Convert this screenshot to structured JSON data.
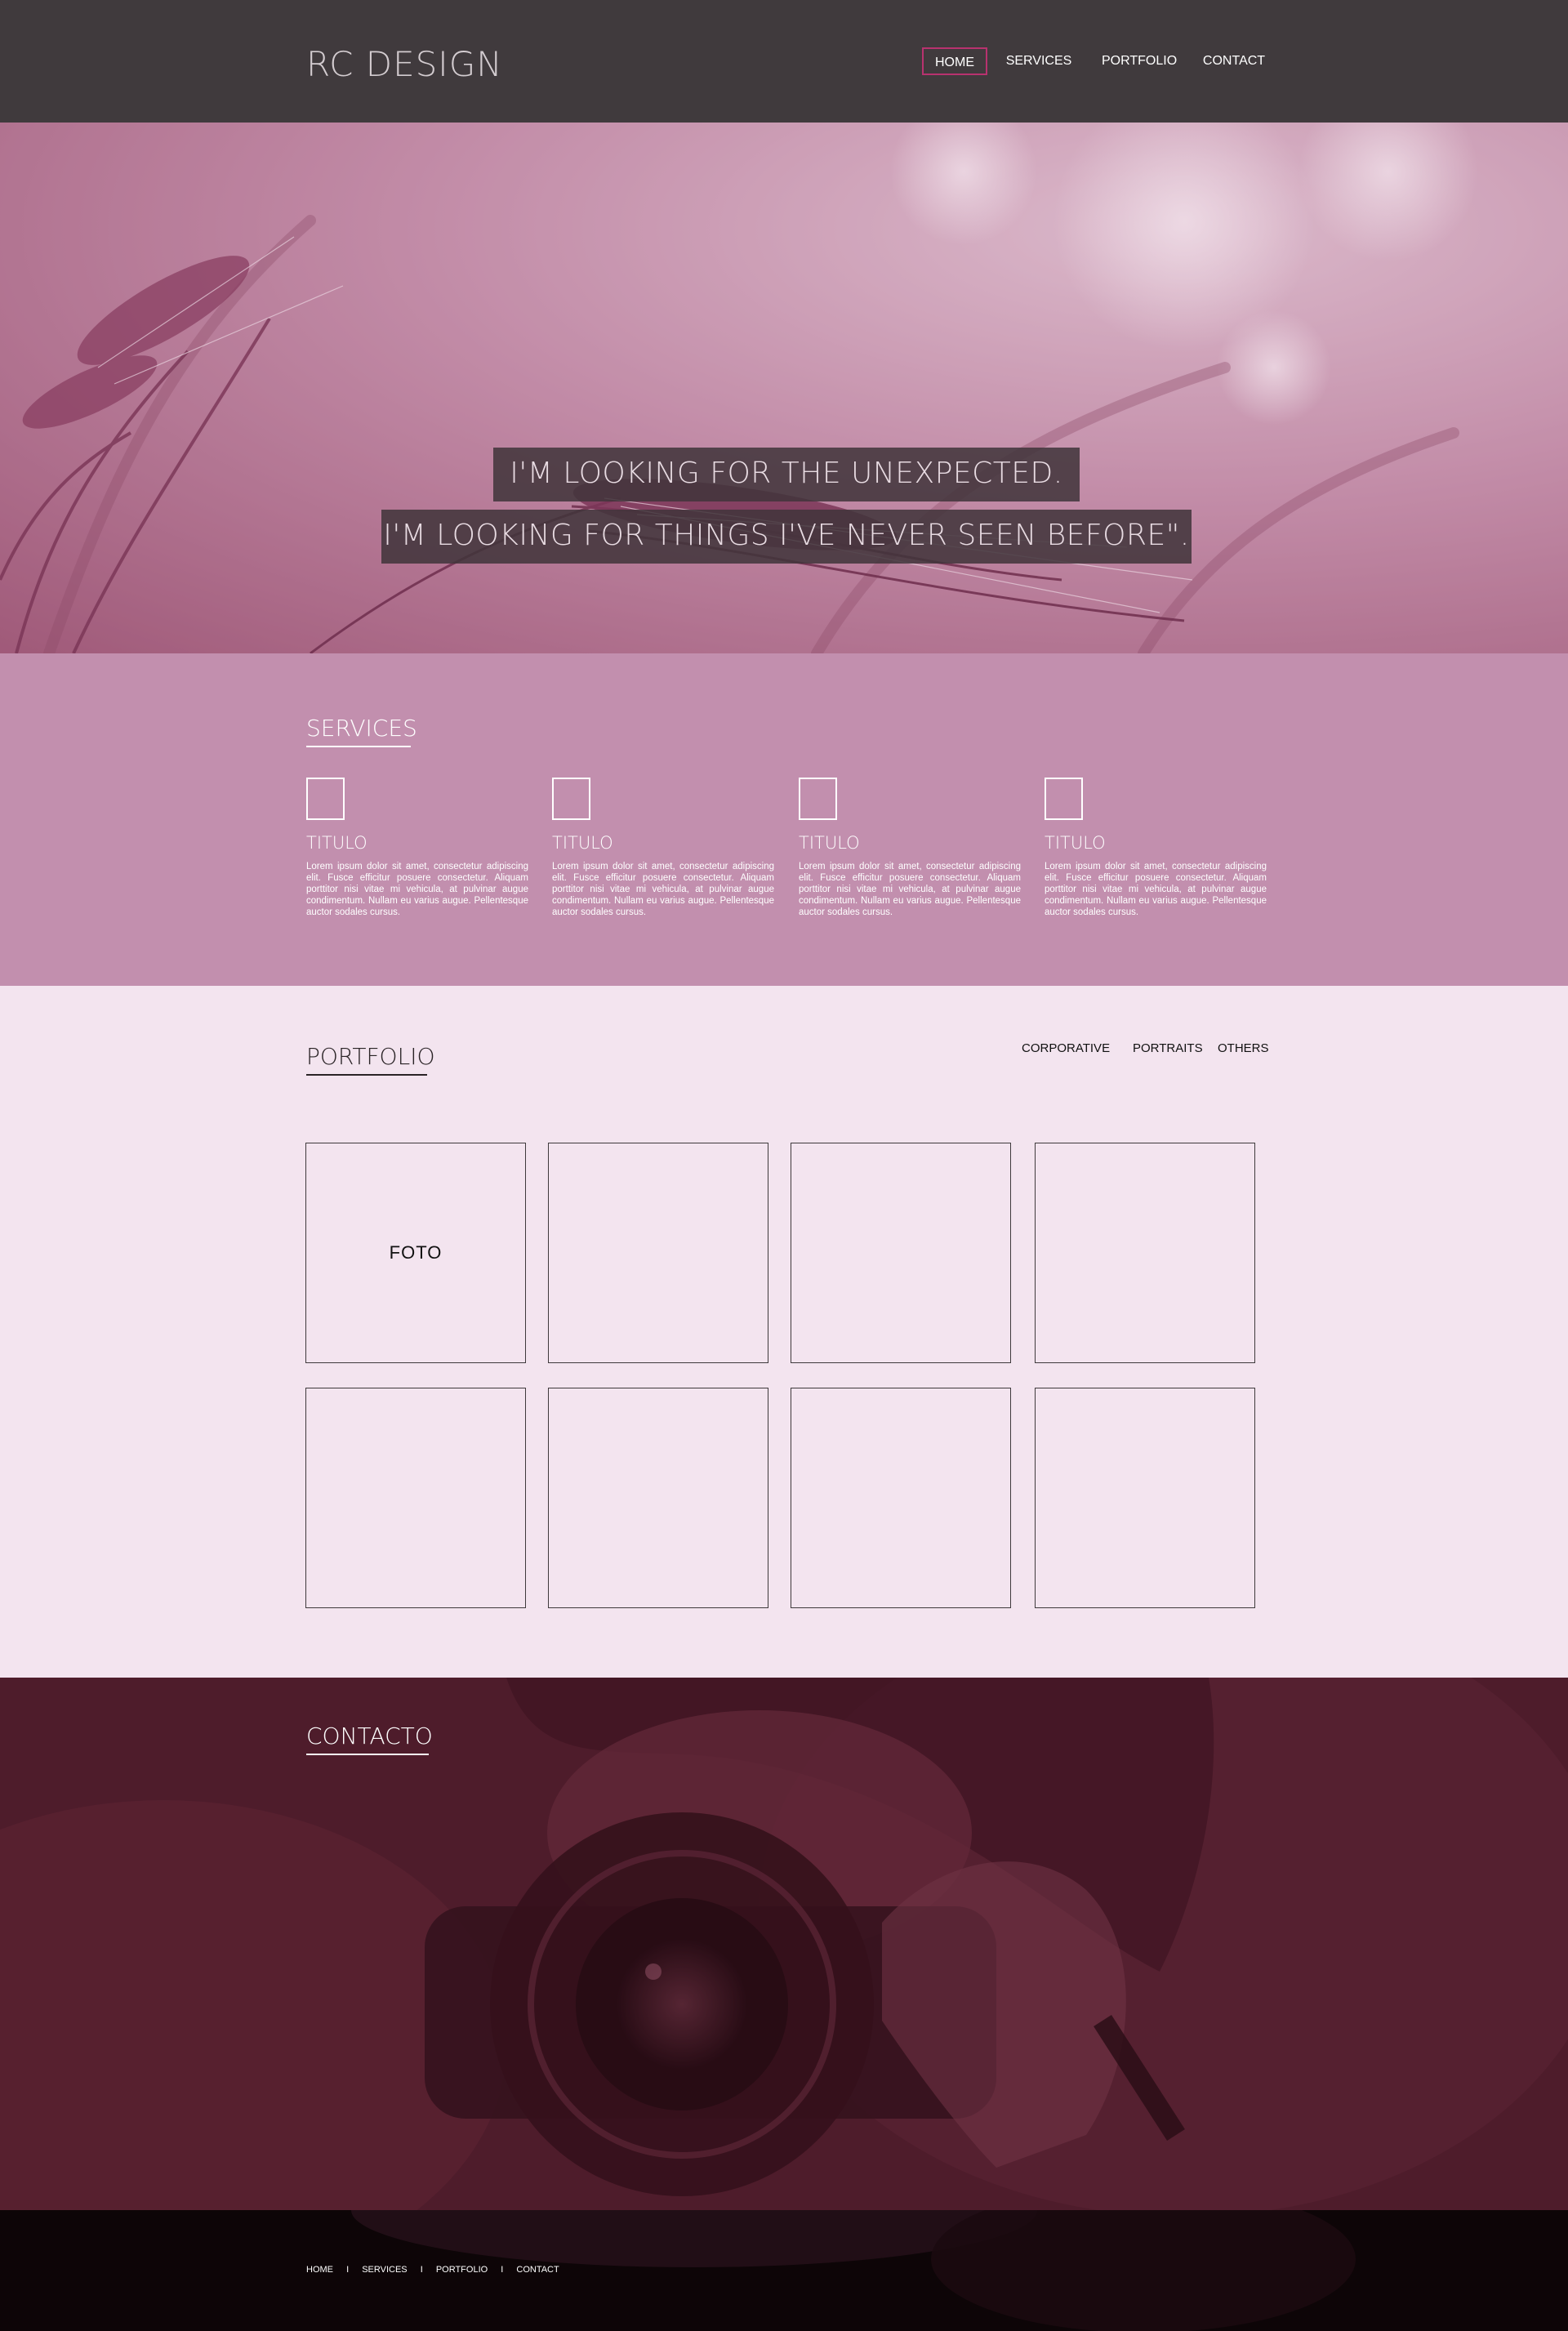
{
  "header": {
    "logo": "RC DESIGN",
    "nav": [
      "HOME",
      "SERVICES",
      "PORTFOLIO",
      "CONTACT"
    ],
    "active": "HOME",
    "accent_color": "#b8326f"
  },
  "hero": {
    "quote_line_1": "I'M LOOKING FOR THE UNEXPECTED.",
    "quote_line_2": "I'M LOOKING FOR THINGS I'VE NEVER SEEN BEFORE\"."
  },
  "services": {
    "title": "SERVICES",
    "items": [
      {
        "icon": "square-outline-icon",
        "title": "TITULO",
        "text": "Lorem ipsum dolor sit amet, consectetur adipiscing elit. Fusce efficitur posuere consectetur. Aliquam porttitor nisi vitae mi vehicula, at pulvinar augue condimentum. Nullam eu varius augue. Pellentesque auctor sodales cursus."
      },
      {
        "icon": "square-outline-icon",
        "title": "TITULO",
        "text": "Lorem ipsum dolor sit amet, consectetur adipiscing elit. Fusce efficitur posuere consectetur. Aliquam porttitor nisi vitae mi vehicula, at pulvinar augue condimentum. Nullam eu varius augue. Pellentesque auctor sodales cursus."
      },
      {
        "icon": "square-outline-icon",
        "title": "TITULO",
        "text": "Lorem ipsum dolor sit amet, consectetur adipiscing elit. Fusce efficitur posuere consectetur. Aliquam porttitor nisi vitae mi vehicula, at pulvinar augue condimentum. Nullam eu varius augue. Pellentesque auctor sodales cursus."
      },
      {
        "icon": "square-outline-icon",
        "title": "TITULO",
        "text": "Lorem ipsum dolor sit amet, consectetur adipiscing elit. Fusce efficitur posuere consectetur. Aliquam porttitor nisi vitae mi vehicula, at pulvinar augue condimentum. Nullam eu varius augue. Pellentesque auctor sodales cursus."
      }
    ]
  },
  "portfolio": {
    "title": "PORTFOLIO",
    "filters": [
      "CORPORATIVE",
      "PORTRAITS",
      "OTHERS"
    ],
    "tile_label": "FOTO"
  },
  "contacto": {
    "title": "CONTACTO"
  },
  "footer": {
    "links": [
      "HOME",
      "SERVICES",
      "PORTFOLIO",
      "CONTACT"
    ],
    "separator": "I"
  },
  "colors": {
    "header_bg": "#403a3d",
    "services_bg": "#c28fae",
    "portfolio_bg": "#f3e4ef",
    "contacto_bg": "#4e1c2b",
    "footer_bg": "#0d0507"
  }
}
